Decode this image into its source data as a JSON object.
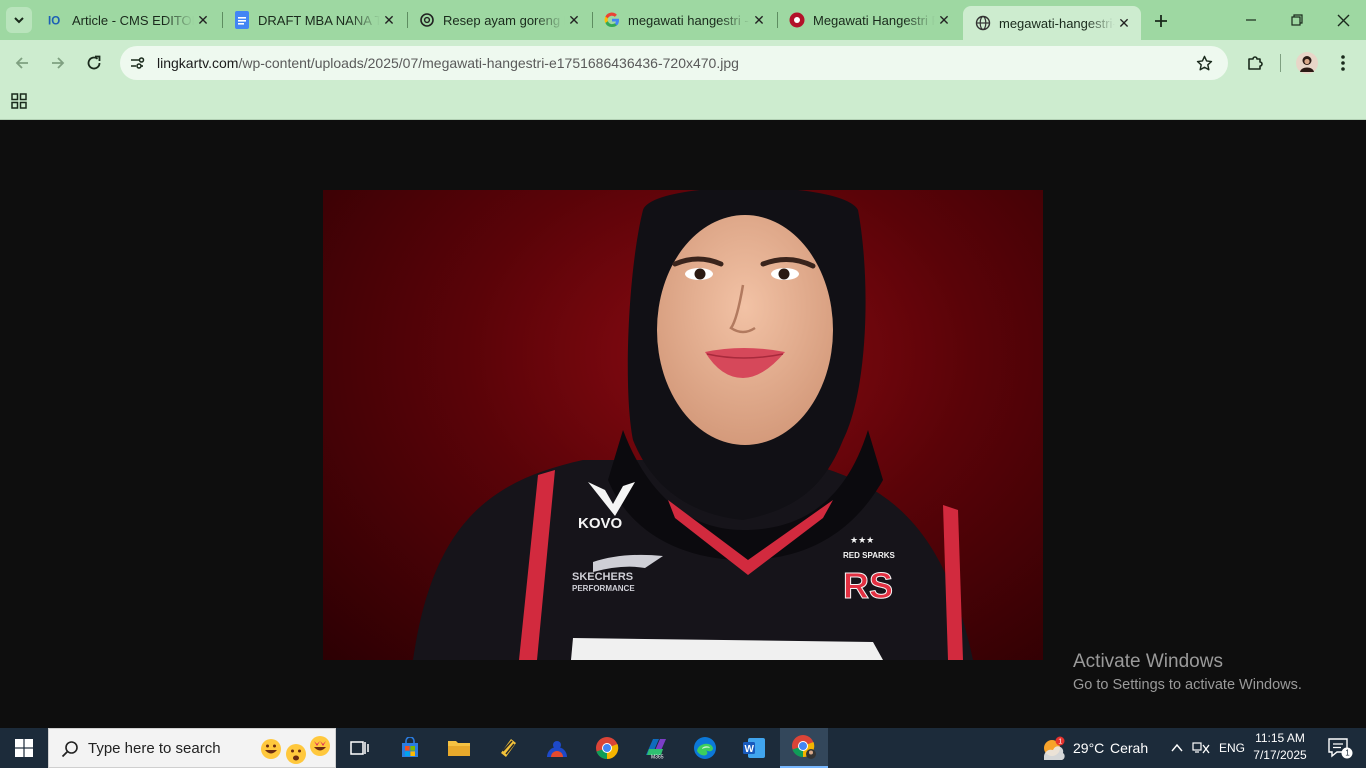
{
  "tabs": [
    {
      "title": "Article - CMS EDITOR",
      "icon": "cms-logo-icon"
    },
    {
      "title": "DRAFT MBA NANA TI",
      "icon": "google-docs-icon"
    },
    {
      "title": "Resep ayam goreng k",
      "icon": "chatgpt-icon"
    },
    {
      "title": "megawati hangestri -",
      "icon": "google-icon"
    },
    {
      "title": "Megawati Hangestri P",
      "icon": "site-red-icon"
    },
    {
      "title": "megawati-hangestri-e",
      "icon": "globe-icon",
      "active": true
    }
  ],
  "address_bar": {
    "domain": "lingkartv.com",
    "path": "/wp-content/uploads/2025/07/megawati-hangestri-e1751686436436-720x470.jpg"
  },
  "image": {
    "jersey_brand": "KOVO",
    "sponsor_line1": "SKECHERS",
    "sponsor_line2": "PERFORMANCE",
    "team_text": "RED SPARKS",
    "team_logo": "RS"
  },
  "watermark": {
    "line1": "Activate Windows",
    "line2": "Go to Settings to activate Windows."
  },
  "taskbar": {
    "search_placeholder": "Type here to search",
    "weather_temp": "29°C",
    "weather_desc": "Cerah",
    "language": "ENG",
    "time": "11:15 AM",
    "date": "7/17/2025",
    "notification_count": "1",
    "weather_badge": "1"
  },
  "colors": {
    "tabstrip": "#9ed8a2",
    "toolbar": "#cdeccf",
    "viewport_bg": "#0e0e0e",
    "taskbar": "#1c2b3a"
  }
}
